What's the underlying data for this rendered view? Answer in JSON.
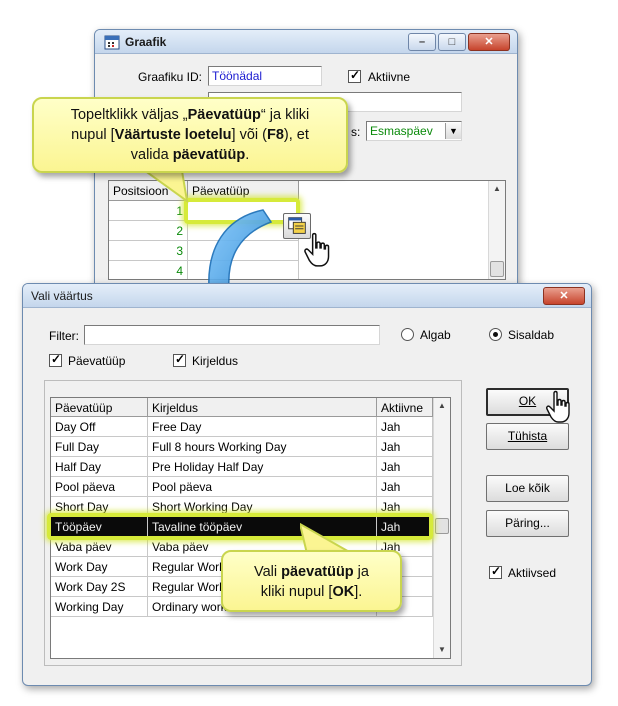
{
  "graafik_window": {
    "title": "Graafik",
    "minimize_glyph": "–",
    "maximize_glyph": "□",
    "close_glyph": "✕",
    "id_label": "Graafiku ID:",
    "id_value": "Töönädal",
    "active_label": "Aktiivne",
    "active_checked": true,
    "start_day_label": "s:",
    "start_day_value": "Esmaspäev",
    "grid": {
      "headers": [
        "Positsioon",
        "Päevatüüp"
      ],
      "positions": [
        "1",
        "2",
        "3",
        "4"
      ]
    }
  },
  "vali_window": {
    "title": "Vali väärtus",
    "close_glyph": "✕",
    "filter_label": "Filter:",
    "filter_value": "",
    "radio_starts": "Algab",
    "radio_contains": "Sisaldab",
    "selected_radio": "Sisaldab",
    "check_daytype": "Päevatüüp",
    "check_description": "Kirjeldus",
    "check_active": "Aktiivsed",
    "columns": [
      "Päevatüüp",
      "Kirjeldus",
      "Aktiivne"
    ],
    "rows": [
      {
        "type": "Day Off",
        "desc": "Free Day",
        "active": "Jah"
      },
      {
        "type": "Full Day",
        "desc": "Full 8 hours Working Day",
        "active": "Jah"
      },
      {
        "type": "Half Day",
        "desc": "Pre Holiday Half Day",
        "active": "Jah"
      },
      {
        "type": "Pool päeva",
        "desc": "Pool päeva",
        "active": "Jah"
      },
      {
        "type": "Short Day",
        "desc": "Short Working Day",
        "active": "Jah"
      },
      {
        "type": "Tööpäev",
        "desc": "Tavaline tööpäev",
        "active": "Jah"
      },
      {
        "type": "Vaba päev",
        "desc": "Vaba päev",
        "active": "Jah"
      },
      {
        "type": "Work Day",
        "desc": "Regular Work",
        "active": ""
      },
      {
        "type": "Work Day 2S",
        "desc": "Regular Work",
        "active": ""
      },
      {
        "type": "Working Day",
        "desc": "Ordinary work",
        "active": ""
      }
    ],
    "selected_row": "Tööpäev",
    "buttons": {
      "ok": "OK",
      "cancel": "Tühista",
      "load_all": "Loe kõik",
      "query": "Päring..."
    }
  },
  "callout_top": {
    "l1a": "Topeltklikk väljas „",
    "l1b": "Päevatüüp",
    "l1c": "“ ja kliki",
    "l2a": "nupul [",
    "l2b": "Väärtuste loetelu",
    "l2c": "] või (",
    "l2d": "F8",
    "l2e": "), et",
    "l3a": "valida ",
    "l3b": "päevatüüp",
    "l3c": "."
  },
  "callout_bottom": {
    "l1a": "Vali ",
    "l1b": "päevatüüp",
    "l1c": " ja",
    "l2a": "kliki nupul [",
    "l2b": "OK",
    "l2c": "]."
  },
  "colors": {
    "title_bar": "#c4d6ec",
    "selected_row": "#0a0a0a",
    "highlight": "#d6ea3a",
    "callout_fill": "#fbf592",
    "arrow": "#3a9be0",
    "position_text": "#0a8a0a",
    "id_text": "#1a1ad0",
    "start_day_text": "#0a8a0a"
  }
}
